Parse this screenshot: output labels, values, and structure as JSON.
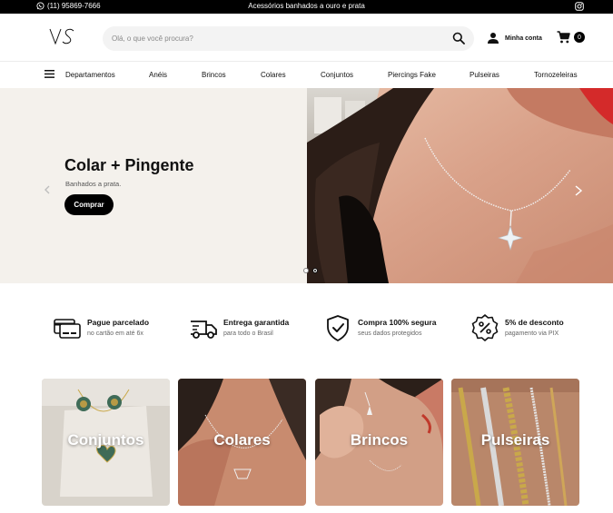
{
  "topbar": {
    "phone": "(11) 95869-7666",
    "promo": "Acessórios banhados a ouro e prata"
  },
  "header": {
    "logo": "VS",
    "search_placeholder": "Olá, o que você procura?",
    "account_label": "Minha conta",
    "cart_count": "0"
  },
  "nav": {
    "items": [
      "Departamentos",
      "Anéis",
      "Brincos",
      "Colares",
      "Conjuntos",
      "Piercings Fake",
      "Pulseiras",
      "Tornozeleiras"
    ]
  },
  "hero": {
    "title": "Colar + Pingente",
    "subtitle": "Banhados a prata.",
    "button": "Comprar",
    "slide_count": 2,
    "active_slide": 2
  },
  "benefits": [
    {
      "title": "Pague parcelado",
      "desc": "no cartão em até 6x",
      "icon": "credit-card-icon"
    },
    {
      "title": "Entrega garantida",
      "desc": "para todo o Brasil",
      "icon": "delivery-truck-icon"
    },
    {
      "title": "Compra 100% segura",
      "desc": "seus dados protegidos",
      "icon": "shield-check-icon"
    },
    {
      "title": "5% de desconto",
      "desc": "pagamento via PIX",
      "icon": "discount-badge-icon"
    }
  ],
  "categories": [
    {
      "label": "Conjuntos"
    },
    {
      "label": "Colares"
    },
    {
      "label": "Brincos"
    },
    {
      "label": "Pulseiras"
    }
  ],
  "colors": {
    "topbar_bg": "#000000",
    "hero_left_bg": "#f4f1ec",
    "accent": "#000000"
  }
}
